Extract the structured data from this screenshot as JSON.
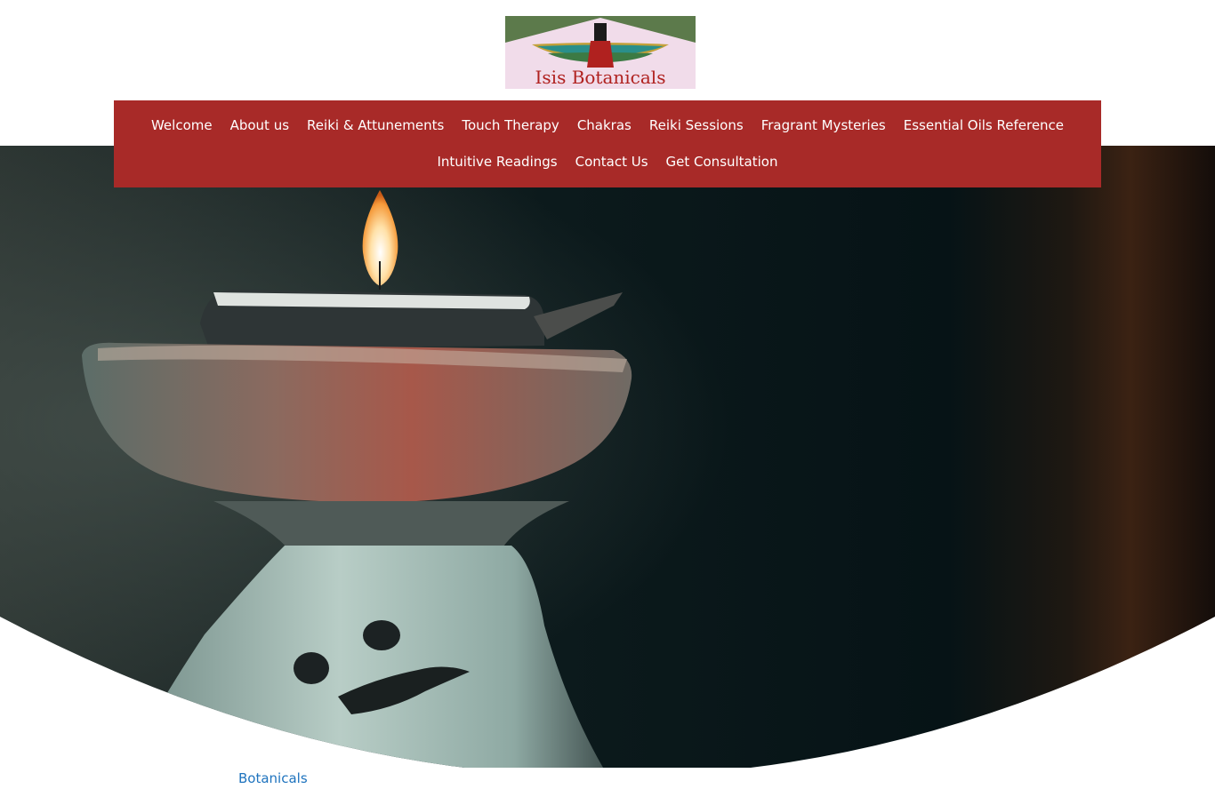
{
  "site": {
    "logo_text": "Isis Botanicals"
  },
  "nav": {
    "row1": [
      {
        "label": "Welcome"
      },
      {
        "label": "About us"
      },
      {
        "label": "Reiki & Attunements"
      },
      {
        "label": "Touch Therapy"
      },
      {
        "label": "Chakras"
      },
      {
        "label": "Reiki Sessions"
      },
      {
        "label": "Fragrant Mysteries"
      },
      {
        "label": "Essential Oils Reference"
      }
    ],
    "row2": [
      {
        "label": "Intuitive Readings"
      },
      {
        "label": "Contact Us"
      },
      {
        "label": "Get Consultation"
      }
    ]
  },
  "content": {
    "breadcrumb_link": "Botanicals"
  },
  "colors": {
    "nav_bg": "#a82a28",
    "link": "#1e73be",
    "logo_green": "#5c7a4b",
    "logo_pink": "#f1dcea",
    "logo_text": "#b0211f"
  },
  "icons": {
    "hero": "oil-burner-candle-image",
    "logo": "isis-winged-goddess-logo"
  }
}
